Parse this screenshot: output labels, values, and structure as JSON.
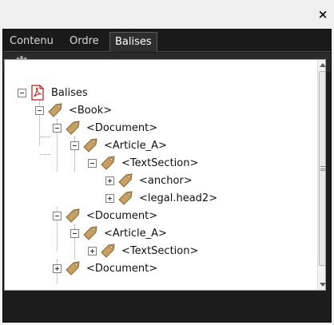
{
  "window": {
    "close_glyph": "×",
    "close_icon": "close-icon"
  },
  "tabs": [
    {
      "label": "Contenu",
      "active": false
    },
    {
      "label": "Ordre",
      "active": false
    },
    {
      "label": "Balises",
      "active": true
    }
  ],
  "toolbar": {
    "options_icon": "gear-icon",
    "dropdown_icon": "caret-down-icon"
  },
  "tree": [
    {
      "label": "Balises",
      "icon": "pdf-icon",
      "toggle": "minus"
    },
    {
      "label": "<Book>",
      "icon": "tag-icon",
      "toggle": "minus"
    },
    {
      "label": "<Document>",
      "icon": "tag-icon",
      "toggle": "minus"
    },
    {
      "label": "<Article_A>",
      "icon": "tag-icon",
      "toggle": "minus"
    },
    {
      "label": "<TextSection>",
      "icon": "tag-icon",
      "toggle": "minus"
    },
    {
      "label": "<anchor>",
      "icon": "tag-icon",
      "toggle": "plus"
    },
    {
      "label": "<legal.head2>",
      "icon": "tag-icon",
      "toggle": "plus"
    },
    {
      "label": "<Document>",
      "icon": "tag-icon",
      "toggle": "minus"
    },
    {
      "label": "<Article_A>",
      "icon": "tag-icon",
      "toggle": "minus"
    },
    {
      "label": "<TextSection>",
      "icon": "tag-icon",
      "toggle": "plus"
    },
    {
      "label": "<Document>",
      "icon": "tag-icon",
      "toggle": "plus"
    }
  ],
  "scrollbar": {
    "up_icon": "scroll-up-arrow-icon",
    "down_icon": "scroll-down-arrow-icon"
  },
  "colors": {
    "panel_bg": "#1c1c1c",
    "tag_icon": "#c8a064",
    "pdf_icon": "#d42020"
  }
}
